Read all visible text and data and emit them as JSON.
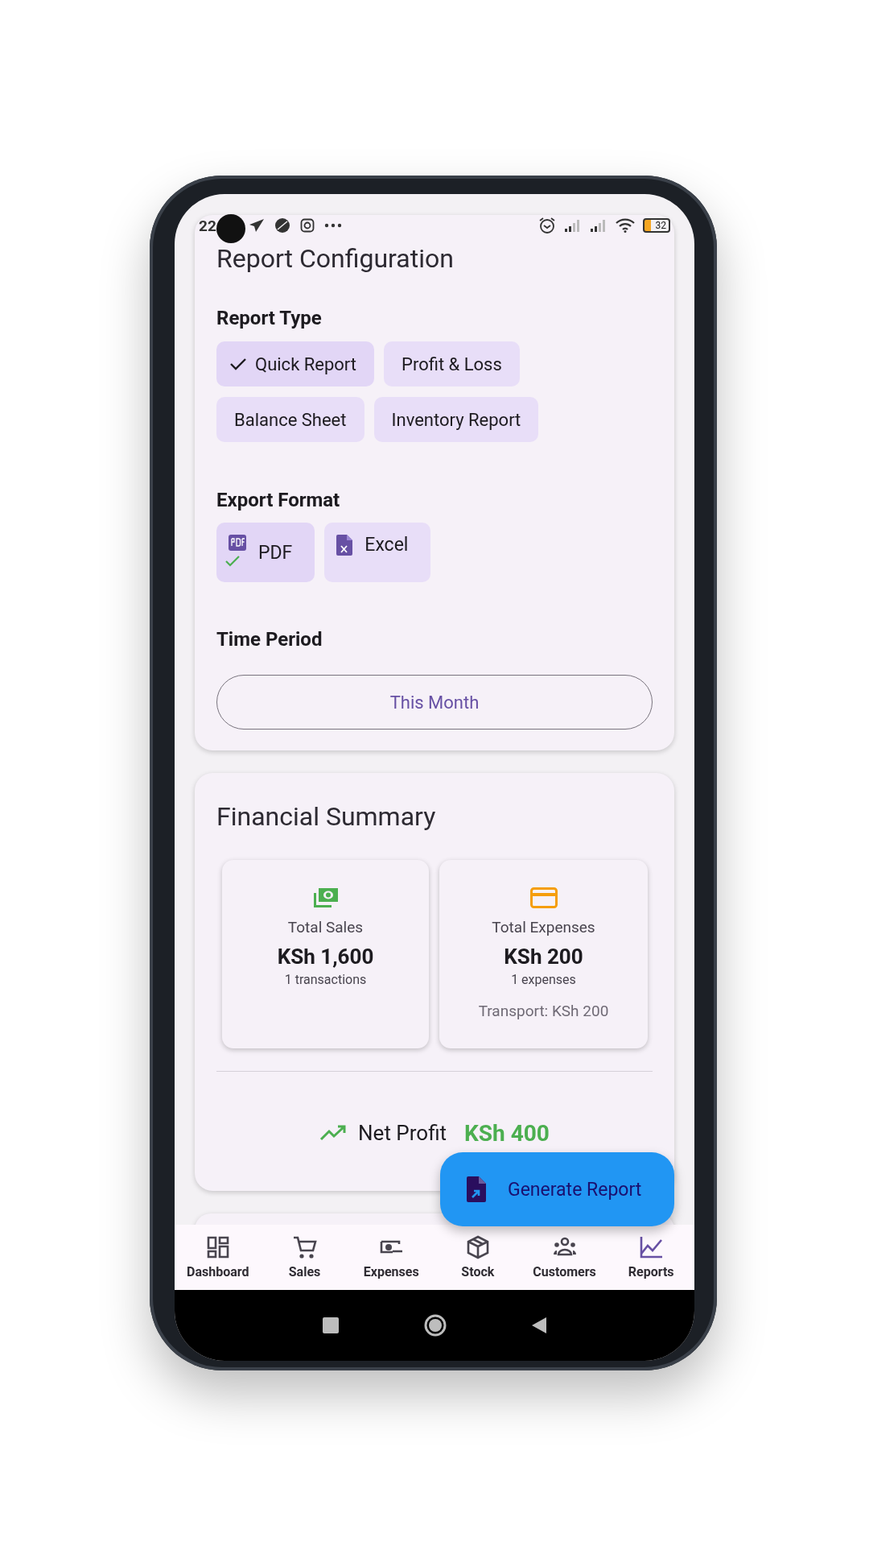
{
  "status_bar": {
    "time": "22",
    "battery": "32"
  },
  "report_config": {
    "title": "Report Configuration",
    "report_type": {
      "label": "Report Type",
      "options": [
        {
          "label": "Quick Report",
          "selected": true
        },
        {
          "label": "Profit & Loss",
          "selected": false
        },
        {
          "label": "Balance Sheet",
          "selected": false
        },
        {
          "label": "Inventory Report",
          "selected": false
        }
      ]
    },
    "export_format": {
      "label": "Export Format",
      "options": [
        {
          "label": "PDF",
          "kind": "pdf",
          "selected": true
        },
        {
          "label": "Excel",
          "kind": "excel",
          "selected": false
        }
      ]
    },
    "time_period": {
      "label": "Time Period",
      "value": "This Month"
    }
  },
  "financial_summary": {
    "title": "Financial Summary",
    "stats": [
      {
        "kind": "sales",
        "label": "Total Sales",
        "amount": "KSh 1,600",
        "count": "1 transactions"
      },
      {
        "kind": "expenses",
        "label": "Total Expenses",
        "amount": "KSh 200",
        "count": "1 expenses",
        "breakdown": [
          "Transport: KSh 200"
        ]
      }
    ],
    "net_profit": {
      "label": "Net Profit",
      "amount": "KSh 400"
    }
  },
  "fab": {
    "label": "Generate Report"
  },
  "bottom_nav": [
    {
      "label": "Dashboard",
      "selected": false
    },
    {
      "label": "Sales",
      "selected": false
    },
    {
      "label": "Expenses",
      "selected": false
    },
    {
      "label": "Stock",
      "selected": false
    },
    {
      "label": "Customers",
      "selected": false
    },
    {
      "label": "Reports",
      "selected": true
    }
  ]
}
